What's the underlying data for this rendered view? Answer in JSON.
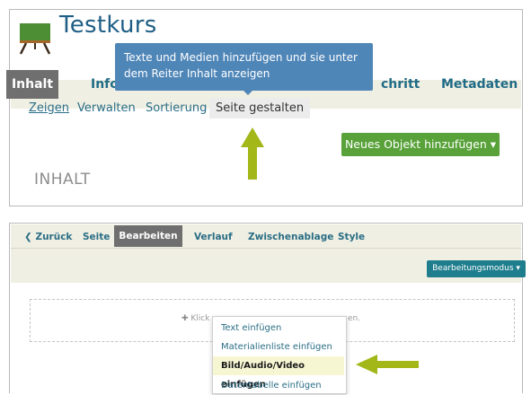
{
  "panel1": {
    "course_title": "Testkurs",
    "tabs": {
      "inhalt": "Inhalt",
      "info": "Info",
      "fortschritt": "chritt",
      "metadaten": "Metadaten"
    },
    "tooltip_line1": "Texte und Medien hinzufügen und sie unter",
    "tooltip_line2": "dem Reiter Inhalt anzeigen",
    "subtabs": {
      "zeigen": "Zeigen",
      "verwalten": "Verwalten",
      "sortierung": "Sortierung",
      "seite_gestalten": "Seite gestalten"
    },
    "new_object_button": "Neues Objekt hinzufügen ▾",
    "content_heading": "INHALT"
  },
  "panel2": {
    "nav": {
      "back": "Zurück",
      "seite": "Seite",
      "bearbeiten": "Bearbeiten",
      "verlauf": "Verlauf",
      "zwischenablage": "Zwischenablage",
      "style": "Style"
    },
    "mode_button": "Bearbeitungsmodus ▾",
    "dropzone_text": "Klick",
    "dropzone_text_tail": "en.",
    "menu_items": [
      "Text einfügen",
      "Materialienliste einfügen",
      "Bild/Audio/Video einfügen",
      "Datentabelle einfügen"
    ]
  },
  "colors": {
    "accent_blue": "#1f5e85",
    "tab_bg": "#f0efe3",
    "active_tab": "#6f6f6f",
    "tooltip": "#4f86b8",
    "primary_button": "#58a239",
    "mode_button": "#1f7e8e",
    "arrow": "#a3b719"
  }
}
